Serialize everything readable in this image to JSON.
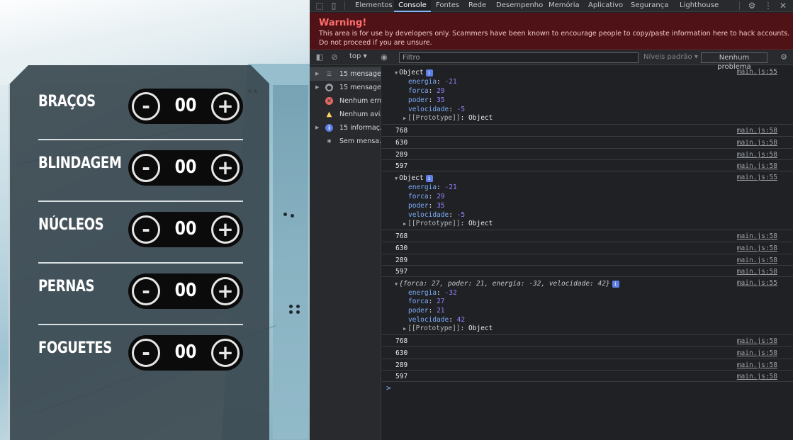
{
  "game": {
    "rows": [
      {
        "label": "BRAÇOS",
        "value": "00"
      },
      {
        "label": "BLINDAGEM",
        "value": "00"
      },
      {
        "label": "NÚCLEOS",
        "value": "00"
      },
      {
        "label": "PERNAS",
        "value": "00"
      },
      {
        "label": "FOGUETES",
        "value": "00"
      }
    ],
    "minus_symbol": "-",
    "plus_symbol": "+"
  },
  "devtools": {
    "tabs": [
      {
        "label": "Elementos"
      },
      {
        "label": "Console",
        "active": true
      },
      {
        "label": "Fontes"
      },
      {
        "label": "Rede"
      },
      {
        "label": "Desempenho"
      },
      {
        "label": "Memória"
      },
      {
        "label": "Aplicativo"
      },
      {
        "label": "Segurança"
      },
      {
        "label": "Lighthouse"
      }
    ],
    "warning": {
      "title": "Warning!",
      "text": "This area is for use by developers only. Scammers have been known to encourage people to copy/paste information here to hack accounts. Do not proceed if you are unsure."
    },
    "toolbar": {
      "context": "top",
      "filter_placeholder": "Filtro",
      "levels": "Níveis padrão",
      "issues": "Nenhum problema"
    },
    "sidebar": [
      {
        "label": "15 mensage...",
        "icon": "list-icon"
      },
      {
        "label": "15 mensage...",
        "icon": "user-icon"
      },
      {
        "label": "Nenhum erro",
        "icon": "error-icon"
      },
      {
        "label": "Nenhum avi...",
        "icon": "warning-icon"
      },
      {
        "label": "15 informaç...",
        "icon": "info-icon"
      },
      {
        "label": "Sem mensa...",
        "icon": "bug-icon"
      }
    ],
    "console": {
      "objects": [
        {
          "head": "Object",
          "energia": "-21",
          "forca": "29",
          "poder": "35",
          "velocidade": "-5",
          "proto": "[[Prototype]]",
          "proto_val": "Object",
          "src": "main.js:55"
        },
        {
          "head": "Object",
          "energia": "-21",
          "forca": "29",
          "poder": "35",
          "velocidade": "-5",
          "proto": "[[Prototype]]",
          "proto_val": "Object",
          "src": "main.js:55"
        },
        {
          "head": "{forca: 27, poder: 21, energia: -32, velocidade: 42}",
          "energia": "-32",
          "forca": "27",
          "poder": "21",
          "velocidade": "42",
          "proto": "[[Prototype]]",
          "proto_val": "Object",
          "src": "main.js:55"
        }
      ],
      "numbers": [
        "768",
        "630",
        "289",
        "597"
      ],
      "number_src": "main.js:58",
      "prompt": ">"
    }
  },
  "colors": {
    "panel": "#3a484f",
    "accent": "#8ab4f8",
    "warning_bg": "#4f1216"
  }
}
